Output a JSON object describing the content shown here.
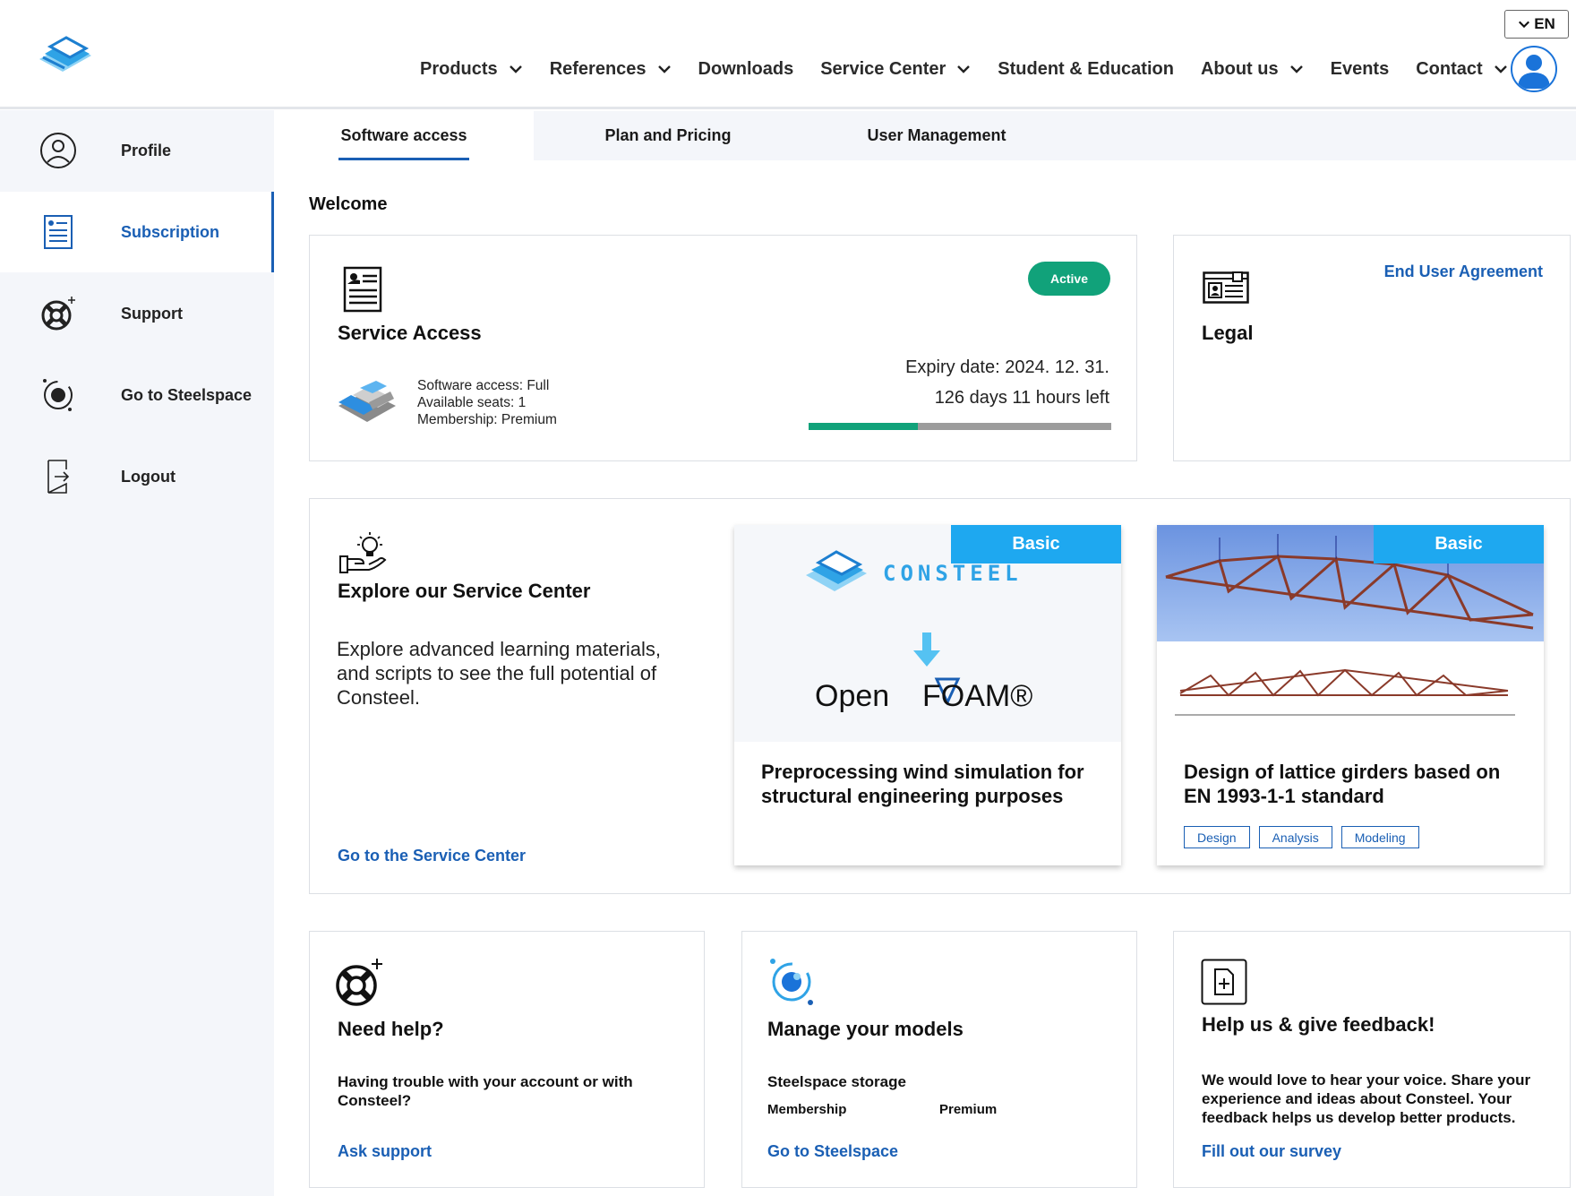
{
  "header": {
    "nav": [
      {
        "label": "Products",
        "has_dropdown": true
      },
      {
        "label": "References",
        "has_dropdown": true
      },
      {
        "label": "Downloads",
        "has_dropdown": false
      },
      {
        "label": "Service Center",
        "has_dropdown": true
      },
      {
        "label": "Student & Education",
        "has_dropdown": false
      },
      {
        "label": "About us",
        "has_dropdown": true
      },
      {
        "label": "Events",
        "has_dropdown": false
      },
      {
        "label": "Contact",
        "has_dropdown": true
      }
    ],
    "language": "EN"
  },
  "sidebar": {
    "items": [
      {
        "label": "Profile",
        "icon": "user-circle-icon"
      },
      {
        "label": "Subscription",
        "icon": "document-list-icon",
        "active": true
      },
      {
        "label": "Support",
        "icon": "lifebuoy-icon"
      },
      {
        "label": "Go to Steelspace",
        "icon": "orbit-icon"
      },
      {
        "label": "Logout",
        "icon": "logout-icon"
      }
    ]
  },
  "tabs": [
    {
      "label": "Software access",
      "active": true
    },
    {
      "label": "Plan and Pricing"
    },
    {
      "label": "User Management"
    }
  ],
  "welcome": "Welcome",
  "service_access": {
    "title": "Service Access",
    "status": "Active",
    "software_access": "Software access: Full",
    "seats": "Available seats: 1",
    "membership": "Membership: Premium",
    "expiry": "Expiry date: 2024. 12. 31.",
    "time_left": "126 days 11 hours left",
    "progress_fraction": 0.36
  },
  "legal": {
    "title": "Legal",
    "link": "End User Agreement"
  },
  "explore": {
    "title": "Explore our Service Center",
    "text": "Explore advanced learning materials, and scripts to see the full potential of Consteel.",
    "link": "Go to the Service Center",
    "cards": [
      {
        "badge": "Basic",
        "title": "Preprocessing wind simulation for structural engineering purposes",
        "logo_text": "CONSTEEL",
        "logo_text_2": "Open",
        "logo_text_3": "FOAM®"
      },
      {
        "badge": "Basic",
        "title": "Design of lattice girders based on EN 1993-1-1 standard",
        "tags": [
          "Design",
          "Analysis",
          "Modeling"
        ]
      }
    ]
  },
  "help": {
    "title": "Need help?",
    "text": "Having trouble with your account or with Consteel?",
    "link": "Ask support"
  },
  "models": {
    "title": "Manage your models",
    "storage": "Steelspace storage",
    "membership_label": "Membership",
    "membership_value": "Premium",
    "link": "Go to Steelspace"
  },
  "feedback": {
    "title": "Help us & give feedback!",
    "text": "We would love to hear your voice. Share your experience and ideas about Consteel. Your feedback helps us develop better products.",
    "link": "Fill out our survey"
  },
  "colors": {
    "brand_blue": "#1a5fb4",
    "active_green": "#11a27a",
    "badge_blue": "#1ea8f0"
  }
}
